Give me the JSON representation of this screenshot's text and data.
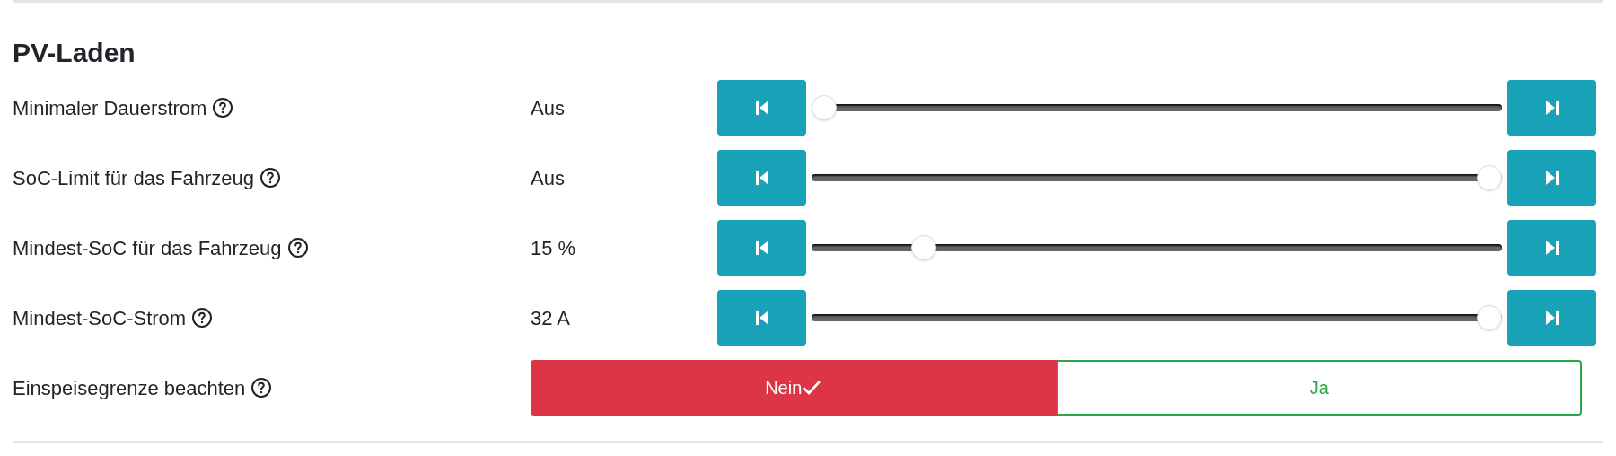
{
  "section": {
    "title": "PV-Laden"
  },
  "rows": [
    {
      "kind": "slider",
      "label": "Minimaler Dauerstrom",
      "value": "Aus",
      "level": 0
    },
    {
      "kind": "slider",
      "label": "SoC-Limit für das Fahrzeug",
      "value": "Aus",
      "level": 1
    },
    {
      "kind": "slider",
      "label": "Mindest-SoC für das Fahrzeug",
      "value": "15 %",
      "level": 0.15
    },
    {
      "kind": "slider",
      "label": "Mindest-SoC-Strom",
      "value": "32 A",
      "level": 1
    },
    {
      "kind": "toggle",
      "label": "Einspeisegrenze beachten",
      "options": [
        {
          "label": "Nein",
          "selected": true,
          "color": "#dc3545"
        },
        {
          "label": "Ja",
          "selected": false,
          "color": "#28a745"
        }
      ]
    }
  ]
}
